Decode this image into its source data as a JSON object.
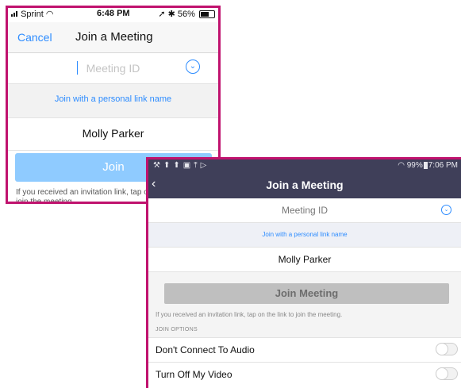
{
  "ios": {
    "status": {
      "carrier": "Sprint",
      "time": "6:48 PM",
      "battery": "56%"
    },
    "nav": {
      "cancel_label": "Cancel",
      "title": "Join a Meeting"
    },
    "meeting_id_placeholder": "Meeting ID",
    "personal_link_label": "Join with a personal link name",
    "name_value": "Molly Parker",
    "join_label": "Join",
    "info_text": "If you received an invitation link, tap on the link again to join the meeting."
  },
  "android": {
    "status": {
      "battery": "99%",
      "time": "7:06 PM"
    },
    "title": "Join a Meeting",
    "meeting_id_placeholder": "Meeting ID",
    "personal_link_label": "Join with a personal link name",
    "name_value": "Molly Parker",
    "join_label": "Join Meeting",
    "info_text": "If you received an invitation link, tap on the link to join the meeting.",
    "section_label": "JOIN OPTIONS",
    "options": [
      {
        "label": "Don't Connect To Audio",
        "enabled": false
      },
      {
        "label": "Turn Off My Video",
        "enabled": false
      }
    ]
  },
  "colors": {
    "frame_border": "#c0126e",
    "accent_blue": "#2d8cff",
    "ios_join_button": "#8fcbff",
    "android_bar": "#3f3f59"
  }
}
